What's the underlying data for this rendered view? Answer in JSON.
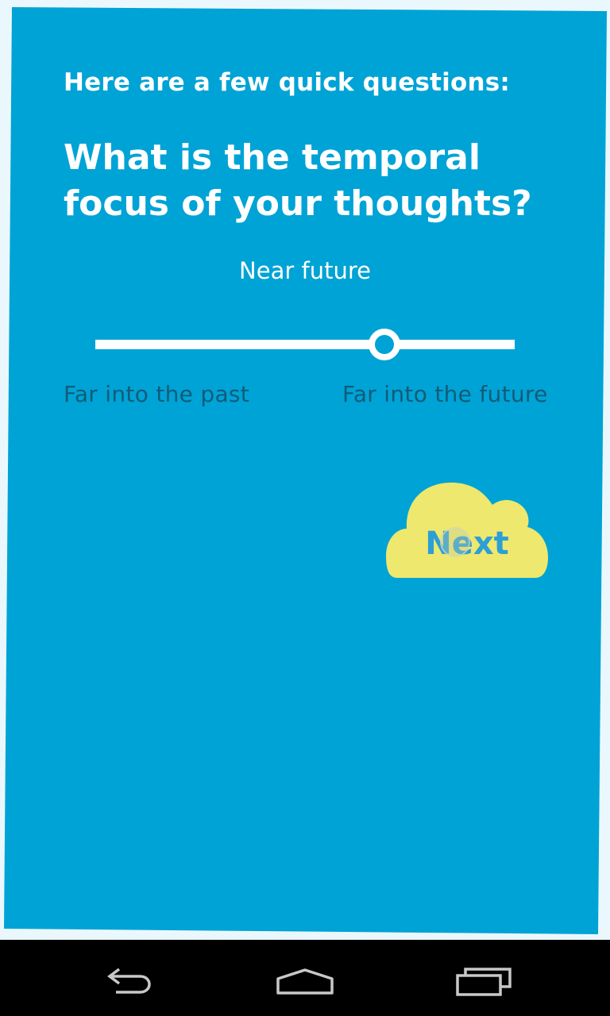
{
  "survey": {
    "intro": "Here are a few quick questions:",
    "question": "What is the temporal focus of your thoughts?"
  },
  "slider": {
    "value_label": "Near future",
    "position": 0.69,
    "min_label": "Far into the past",
    "max_label": "Far into the future"
  },
  "next_button": {
    "label": "Next"
  },
  "colors": {
    "background": "#00a3d5",
    "cloud": "#eee86e",
    "next_text": "#2c9fd6",
    "scale_labels": "#115c7a"
  },
  "nav_bar": {
    "icons": [
      "back-icon",
      "home-icon",
      "recents-icon"
    ]
  }
}
